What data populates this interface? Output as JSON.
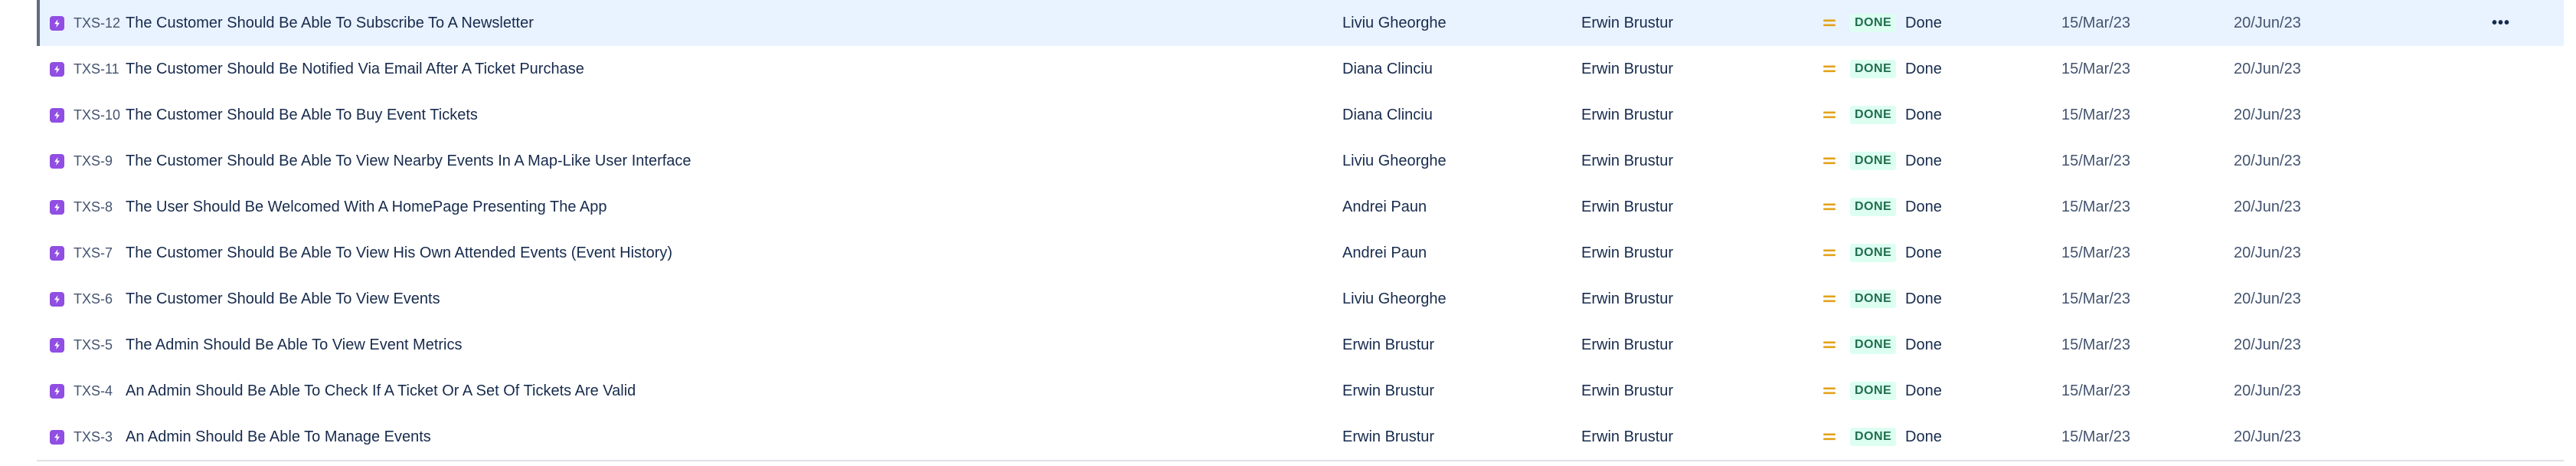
{
  "issues": {
    "more_actions_label": "•••",
    "rows": [
      {
        "key": "TXS-12",
        "summary": "The Customer Should Be Able To Subscribe To A Newsletter",
        "assignee": "Liviu Gheorghe",
        "reporter": "Erwin Brustur",
        "status": "DONE",
        "resolution": "Done",
        "created": "15/Mar/23",
        "updated": "20/Jun/23"
      },
      {
        "key": "TXS-11",
        "summary": "The Customer Should Be Notified Via Email After A Ticket Purchase",
        "assignee": "Diana Clinciu",
        "reporter": "Erwin Brustur",
        "status": "DONE",
        "resolution": "Done",
        "created": "15/Mar/23",
        "updated": "20/Jun/23"
      },
      {
        "key": "TXS-10",
        "summary": "The Customer Should Be Able To Buy Event Tickets",
        "assignee": "Diana Clinciu",
        "reporter": "Erwin Brustur",
        "status": "DONE",
        "resolution": "Done",
        "created": "15/Mar/23",
        "updated": "20/Jun/23"
      },
      {
        "key": "TXS-9",
        "summary": "The Customer Should Be Able To View Nearby Events In A Map-Like User Interface",
        "assignee": "Liviu Gheorghe",
        "reporter": "Erwin Brustur",
        "status": "DONE",
        "resolution": "Done",
        "created": "15/Mar/23",
        "updated": "20/Jun/23"
      },
      {
        "key": "TXS-8",
        "summary": "The User Should Be Welcomed With A HomePage Presenting The App",
        "assignee": "Andrei Paun",
        "reporter": "Erwin Brustur",
        "status": "DONE",
        "resolution": "Done",
        "created": "15/Mar/23",
        "updated": "20/Jun/23"
      },
      {
        "key": "TXS-7",
        "summary": "The Customer Should Be Able To View His Own Attended Events (Event History)",
        "assignee": "Andrei Paun",
        "reporter": "Erwin Brustur",
        "status": "DONE",
        "resolution": "Done",
        "created": "15/Mar/23",
        "updated": "20/Jun/23"
      },
      {
        "key": "TXS-6",
        "summary": "The Customer Should Be Able To View Events",
        "assignee": "Liviu Gheorghe",
        "reporter": "Erwin Brustur",
        "status": "DONE",
        "resolution": "Done",
        "created": "15/Mar/23",
        "updated": "20/Jun/23"
      },
      {
        "key": "TXS-5",
        "summary": "The Admin Should Be Able To View Event Metrics",
        "assignee": "Erwin Brustur",
        "reporter": "Erwin Brustur",
        "status": "DONE",
        "resolution": "Done",
        "created": "15/Mar/23",
        "updated": "20/Jun/23"
      },
      {
        "key": "TXS-4",
        "summary": "An Admin Should Be Able To Check If A Ticket Or A Set Of Tickets Are Valid",
        "assignee": "Erwin Brustur",
        "reporter": "Erwin Brustur",
        "status": "DONE",
        "resolution": "Done",
        "created": "15/Mar/23",
        "updated": "20/Jun/23"
      },
      {
        "key": "TXS-3",
        "summary": "An Admin Should Be Able To Manage Events",
        "assignee": "Erwin Brustur",
        "reporter": "Erwin Brustur",
        "status": "DONE",
        "resolution": "Done",
        "created": "15/Mar/23",
        "updated": "20/Jun/23"
      }
    ],
    "selected_row": 0,
    "issue_type_icon": "story-icon",
    "priority_icon": "priority-medium-icon",
    "colors": {
      "issue_type": "#904ee2",
      "priority_medium": "#e2a21a",
      "status_done_bg": "#dcfff1",
      "status_done_text": "#216e4e",
      "selected_row_bg": "#e9f2ff"
    }
  }
}
